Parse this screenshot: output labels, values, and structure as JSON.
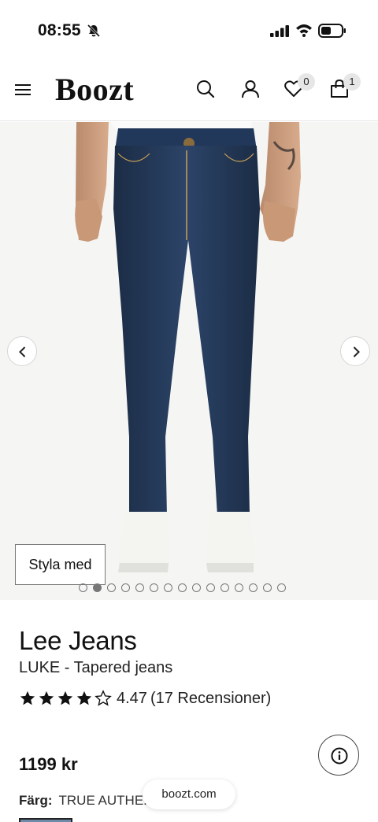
{
  "status_bar": {
    "time": "08:55"
  },
  "header": {
    "logo": "Boozt",
    "wishlist_count": "0",
    "bag_count": "1"
  },
  "gallery": {
    "style_button": "Styla med",
    "slide_count": 15,
    "active_slide": 2
  },
  "product": {
    "brand": "Lee Jeans",
    "name": "LUKE - Tapered jeans",
    "rating": 4.47,
    "rating_text": "4.47",
    "reviews_text": "(17 Recensioner)",
    "stars_filled": 4,
    "price": "1199 kr",
    "color_label": "Färg:",
    "color_value": "TRUE AUTHE..."
  },
  "browser": {
    "url": "boozt.com"
  },
  "colors": {
    "denim": "#243a5a",
    "background": "#f5f5f3",
    "text": "#111111"
  },
  "icons": [
    "bell-slash-icon",
    "signal-icon",
    "wifi-icon",
    "battery-icon",
    "menu-icon",
    "search-icon",
    "account-icon",
    "heart-icon",
    "bag-icon",
    "chevron-left-icon",
    "chevron-right-icon",
    "star-icon",
    "info-icon"
  ]
}
